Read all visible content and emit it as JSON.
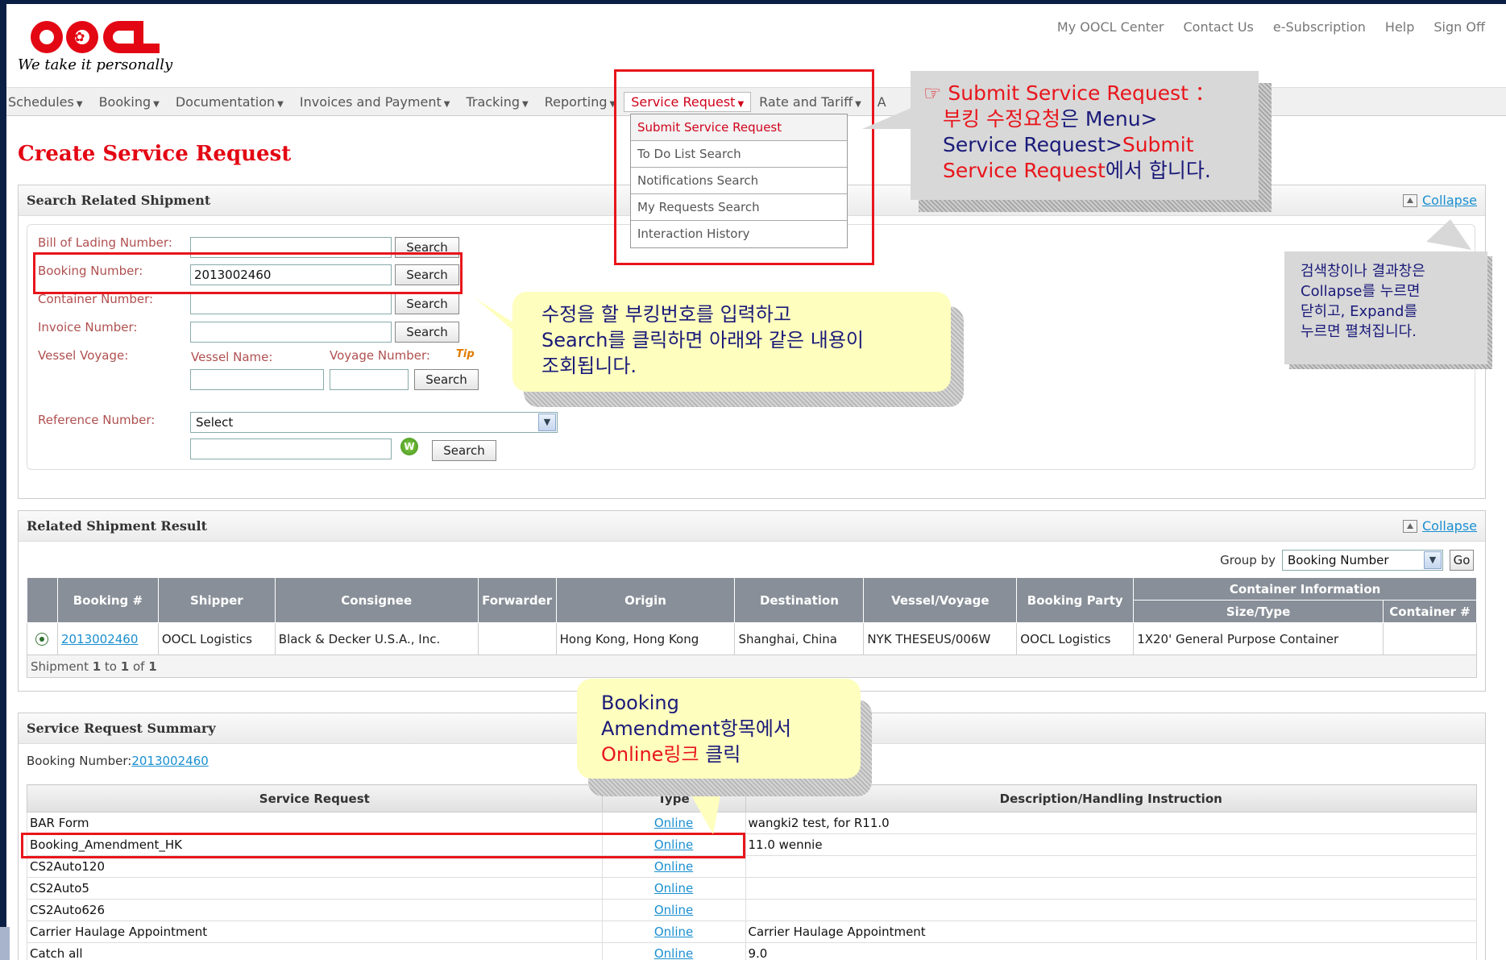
{
  "brand": {
    "tagline": "We take it personally"
  },
  "top_links": [
    "My OOCL Center",
    "Contact Us",
    "e-Subscription",
    "Help",
    "Sign Off"
  ],
  "nav": {
    "items": [
      "Schedules",
      "Booking",
      "Documentation",
      "Invoices and Payment",
      "Tracking",
      "Reporting",
      "Service Request",
      "Rate and Tariff",
      "A"
    ],
    "dropdown": [
      "Submit Service Request",
      "To Do List Search",
      "Notifications Search",
      "My Requests Search",
      "Interaction History"
    ]
  },
  "page_title": "Create Service Request",
  "search_panel": {
    "title": "Search Related Shipment",
    "collapse": "Collapse",
    "bl_label": "Bill of Lading Number:",
    "booking_label": "Booking Number:",
    "booking_value": "2013002460",
    "container_label": "Container Number:",
    "invoice_label": "Invoice Number:",
    "vessel_voyage_label": "Vessel Voyage:",
    "vessel_name_label": "Vessel Name:",
    "voyage_number_label": "Voyage Number:",
    "tip": "Tip",
    "reference_label": "Reference Number:",
    "reference_select": "Select",
    "search_btn": "Search"
  },
  "result_panel": {
    "title": "Related Shipment Result",
    "collapse": "Collapse",
    "group_by_label": "Group by",
    "group_by_value": "Booking Number",
    "go": "Go",
    "headers": [
      "Booking #",
      "Shipper",
      "Consignee",
      "Forwarder",
      "Origin",
      "Destination",
      "Vessel/Voyage",
      "Booking Party",
      "Container Information",
      "Size/Type",
      "Container #"
    ],
    "row": {
      "booking": "2013002460",
      "shipper": "OOCL Logistics",
      "consignee": "Black & Decker U.S.A., Inc.",
      "forwarder": "",
      "origin": "Hong Kong, Hong Kong",
      "destination": "Shanghai, China",
      "vessel": "NYK THESEUS/006W",
      "booking_party": "OOCL Logistics",
      "size_type": "1X20' General Purpose Container",
      "container": ""
    },
    "footer": {
      "prefix": "Shipment ",
      "from": "1",
      "to_word": " to ",
      "to": "1",
      "of_word": " of ",
      "total": "1"
    }
  },
  "summary_panel": {
    "title": "Service Request Summary",
    "booking_label": "Booking Number:",
    "booking_value": "2013002460",
    "headers": [
      "Service Request",
      "Type",
      "Description/Handling Instruction"
    ],
    "rows": [
      {
        "name": "BAR Form",
        "type": "Online",
        "desc": "wangki2 test, for R11.0"
      },
      {
        "name": "Booking_Amendment_HK",
        "type": "Online",
        "desc": "11.0 wennie"
      },
      {
        "name": "CS2Auto120",
        "type": "Online",
        "desc": ""
      },
      {
        "name": "CS2Auto5",
        "type": "Online",
        "desc": ""
      },
      {
        "name": "CS2Auto626",
        "type": "Online",
        "desc": ""
      },
      {
        "name": "Carrier Haulage Appointment",
        "type": "Online",
        "desc": "Carrier Haulage Appointment"
      },
      {
        "name": "Catch all",
        "type": "Online",
        "desc": "9.0"
      }
    ]
  },
  "annotations": {
    "submit_note": {
      "l1a": "☞ Submit Service Request ：",
      "l2a": "부킹 수정요청",
      "l2b": "은 Menu>",
      "l3": "Service Request>",
      "l3b": "Submit",
      "l4a": "Service Request",
      "l4b": "에서 합니다."
    },
    "collapse_note": [
      "검색창이나 결과창은",
      "Collapse를 누르면",
      "닫히고, Expand를",
      "누르면 펼쳐집니다."
    ],
    "search_note": [
      "수정을 할 부킹번호를 입력하고",
      "Search를 클릭하면 아래와 같은 내용이",
      "조회됩니다."
    ],
    "online_note": {
      "l1": "Booking",
      "l2": "Amendment항목에서",
      "l3a": "Online링크",
      "l3b": " 클릭"
    }
  }
}
